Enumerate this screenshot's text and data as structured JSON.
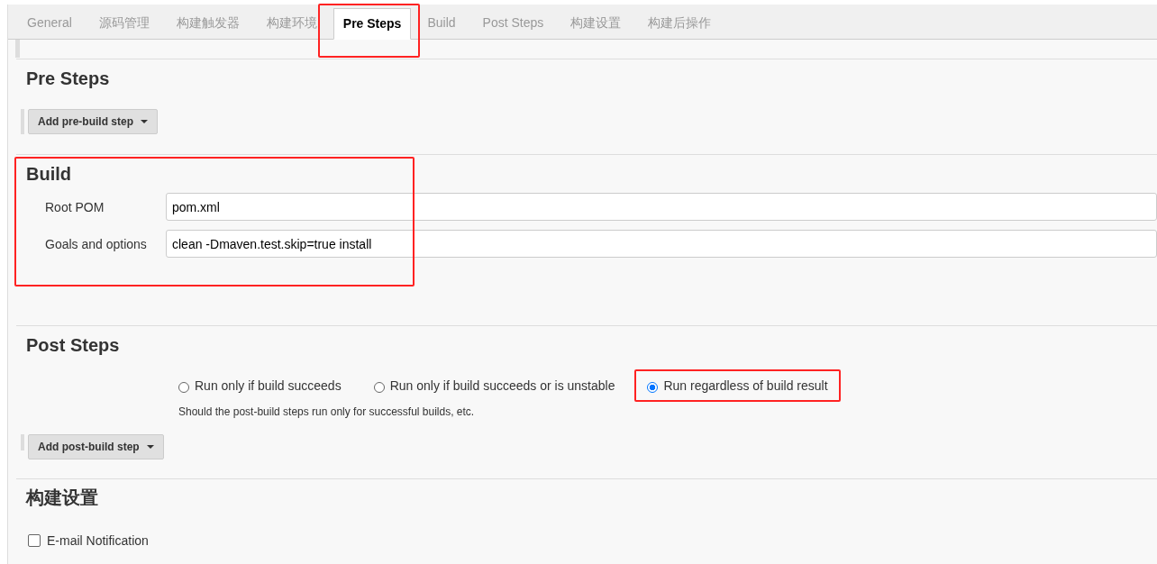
{
  "tabs": [
    {
      "label": "General",
      "selected": false,
      "highlighted": false
    },
    {
      "label": "源码管理",
      "selected": false,
      "highlighted": false
    },
    {
      "label": "构建触发器",
      "selected": false,
      "highlighted": false
    },
    {
      "label": "构建环境",
      "selected": false,
      "highlighted": false
    },
    {
      "label": "Pre Steps",
      "selected": true,
      "highlighted": true
    },
    {
      "label": "Build",
      "selected": false,
      "highlighted": false
    },
    {
      "label": "Post Steps",
      "selected": false,
      "highlighted": false
    },
    {
      "label": "构建设置",
      "selected": false,
      "highlighted": false
    },
    {
      "label": "构建后操作",
      "selected": false,
      "highlighted": false
    }
  ],
  "sections": [
    {
      "kind": "steps",
      "title": "Pre Steps",
      "highlighted": false,
      "button": "Add pre-build step"
    },
    {
      "kind": "fields",
      "title": "Build",
      "highlighted": true,
      "fields": [
        {
          "label": "Root POM",
          "value": "pom.xml"
        },
        {
          "label": "Goals and options",
          "value": "clean -Dmaven.test.skip=true install"
        }
      ]
    },
    {
      "kind": "post",
      "title": "Post Steps",
      "highlighted": false,
      "options": [
        {
          "label": "Run only if build succeeds",
          "selected": false,
          "highlighted": false
        },
        {
          "label": "Run only if build succeeds or is unstable",
          "selected": false,
          "highlighted": false
        },
        {
          "label": "Run regardless of build result",
          "selected": true,
          "highlighted": true
        }
      ],
      "help": "Should the post-build steps run only for successful builds, etc.",
      "button": "Add post-build step"
    },
    {
      "kind": "checks",
      "title": "构建设置",
      "highlighted": false,
      "checkboxes": [
        {
          "label": "E-mail Notification",
          "checked": false
        }
      ]
    }
  ]
}
